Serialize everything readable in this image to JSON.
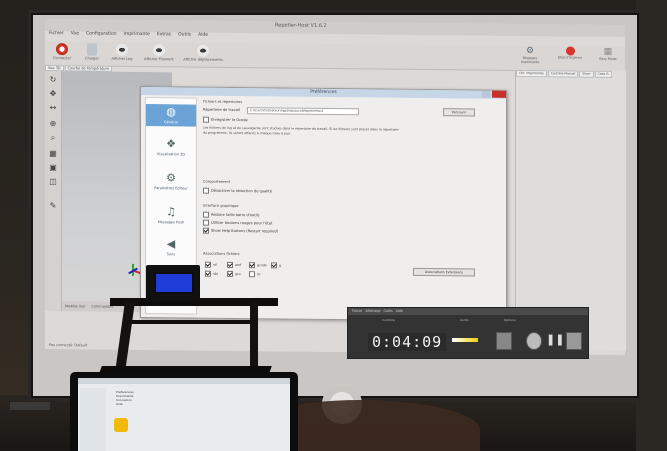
{
  "app": {
    "title": "Repetier-Host V1.6.2",
    "menu": [
      "Fichier",
      "Vue",
      "Configuration",
      "Imprimante",
      "Extras",
      "Outils",
      "Aide"
    ],
    "toolbar": [
      {
        "label": "Connecter",
        "icon": "power-icon"
      },
      {
        "label": "Charger",
        "icon": "file-icon"
      },
      {
        "label": "Afficher Log",
        "icon": "eye-icon"
      },
      {
        "label": "Afficher Filament",
        "icon": "eye-icon"
      },
      {
        "label": "Afficher déplacements",
        "icon": "eye-icon"
      }
    ],
    "tabs": [
      "Vue 3D",
      "Courbe de Température"
    ],
    "right_top": [
      {
        "label": "Réglages Imprimante",
        "icon": "gear-icon"
      },
      {
        "label": "Stop d'Urgence",
        "icon": "stop-icon"
      },
      {
        "label": "Easy Mode",
        "icon": "grid-icon"
      }
    ],
    "right_tabs": [
      "Ctrl. Imprimante",
      "Contrôle Manuel",
      "Slicer",
      "Code G"
    ],
    "viewport_footer": [
      "Modèle Vue",
      "Commandes"
    ],
    "status": "Pas connecté: Default"
  },
  "dialog": {
    "title": "Préférences",
    "sidebar": [
      {
        "label": "Général",
        "icon": "globe-icon",
        "active": true
      },
      {
        "label": "Visualisation 3D",
        "icon": "cubes-icon",
        "active": false
      },
      {
        "label": "Paramètres Éditeur",
        "icon": "gears-icon",
        "active": false
      },
      {
        "label": "Messages Push",
        "icon": "bell-icon",
        "active": false
      },
      {
        "label": "Sons",
        "icon": "speaker-icon",
        "active": false
      }
    ],
    "general": {
      "section_files": "Fichiers et répertoires",
      "workdir_label": "Répertoire de travail",
      "workdir_value": "C:\\Users\\Ordinateur\\AppData\\Local\\RepetierHost",
      "browse_label": "Parcourir",
      "save_label": "Enregistrer le Gcode",
      "description": "Les fichiers de log et de sauvegarde sont stockés dans le répertoire de travail. Si les fichiers sont placés dans le répertoire du programme, ils seront effacés à chaque mise à jour.",
      "section_behavior": "Comportement",
      "disable_quality": "Désactiver la réduction de qualité",
      "section_gui": "Interface graphique",
      "reduce_toolbar": "Réduire taille barre d'outils",
      "red_buttons": "Utiliser boutons rouges pour l'état",
      "show_help": "Show Help Buttons (Restart required)",
      "section_ext": "Associations fichiers",
      "extensions": [
        {
          "ext": "stl",
          "on": true
        },
        {
          "ext": "amf",
          "on": true
        },
        {
          "ext": "gcode",
          "on": true
        },
        {
          "ext": "g",
          "on": true
        },
        {
          "ext": "obj",
          "on": true
        },
        {
          "ext": "gco",
          "on": true
        },
        {
          "ext": "nc",
          "on": false
        }
      ],
      "assoc_button": "Associations Extensions"
    }
  },
  "timer": {
    "value": "0:04:09",
    "header": [
      "Fichier",
      "Affichage",
      "Outils",
      "Aide"
    ],
    "labels": [
      "Contrôle",
      "Audio",
      "Options"
    ]
  },
  "lcd": {
    "text": ""
  },
  "laptop": {
    "lines": [
      "Preferences",
      "Imprimante",
      "Connexion",
      "Aide"
    ]
  }
}
